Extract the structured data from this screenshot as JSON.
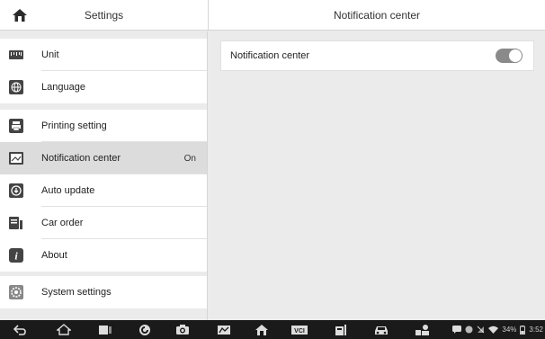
{
  "header": {
    "left_title": "Settings",
    "right_title": "Notification center"
  },
  "sidebar": {
    "items": [
      {
        "label": "Unit",
        "icon": "ruler-icon"
      },
      {
        "label": "Language",
        "icon": "globe-icon"
      },
      {
        "label": "Printing setting",
        "icon": "printer-icon"
      },
      {
        "label": "Notification center",
        "icon": "notification-icon",
        "value": "On",
        "selected": true
      },
      {
        "label": "Auto update",
        "icon": "update-icon"
      },
      {
        "label": "Car order",
        "icon": "car-order-icon"
      },
      {
        "label": "About",
        "icon": "info-icon"
      },
      {
        "label": "System settings",
        "icon": "gear-icon"
      }
    ]
  },
  "main": {
    "setting_label": "Notification center",
    "toggle_on": true
  },
  "statusbar": {
    "battery": "34%",
    "time": "3:52"
  },
  "colors": {
    "background": "#ebebeb",
    "selected": "#dcdcdc",
    "toggle": "#8a8a8a",
    "navbar": "#1a1a1a"
  }
}
